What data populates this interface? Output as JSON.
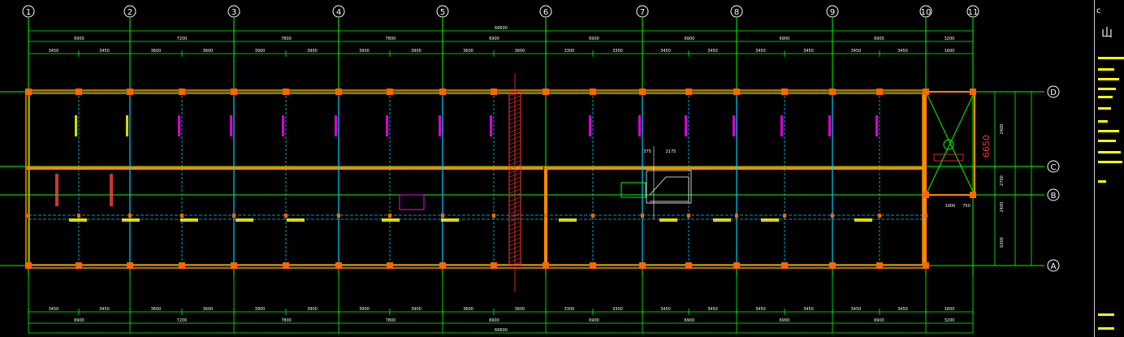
{
  "colors": {
    "background": "#000000",
    "axis_line": "#00ff00",
    "wall": "#ff8800",
    "column": "#ff6600",
    "beam": "#00ccff",
    "annotation_magenta": "#ff00ff",
    "annotation_yellow": "#ffff00",
    "dimension_text": "#ffffff",
    "hatch": "#ff3333"
  },
  "axes": {
    "vertical": [
      {
        "id": "1",
        "label": "1"
      },
      {
        "id": "2",
        "label": "2"
      },
      {
        "id": "3",
        "label": "3"
      },
      {
        "id": "4",
        "label": "4"
      },
      {
        "id": "5",
        "label": "5"
      },
      {
        "id": "6",
        "label": "6"
      },
      {
        "id": "7",
        "label": "7"
      },
      {
        "id": "8",
        "label": "8"
      },
      {
        "id": "9",
        "label": "9"
      },
      {
        "id": "10",
        "label": "10"
      },
      {
        "id": "11",
        "label": "11"
      }
    ],
    "horizontal": [
      {
        "id": "D",
        "label": "D"
      },
      {
        "id": "C",
        "label": "C"
      },
      {
        "id": "B",
        "label": "B"
      },
      {
        "id": "A",
        "label": "A"
      }
    ]
  },
  "dimensions": {
    "top_total": "66600",
    "bottom_total": "66600",
    "top_bays": [
      "6900",
      "7200",
      "7800",
      "7800",
      "6900",
      "6900",
      "6900",
      "6900",
      "6900",
      "3200"
    ],
    "bottom_bays": [
      "6900",
      "7200",
      "7800",
      "7800",
      "6900",
      "6900",
      "6900",
      "6900",
      "6900",
      "3200"
    ],
    "top_sub": [
      "3450",
      "3450",
      "3600",
      "3600",
      "3900",
      "3900",
      "3900",
      "3900",
      "3600",
      "3600",
      "3300",
      "3300",
      "3450",
      "3450",
      "3450",
      "3450",
      "3450",
      "3450",
      "1600"
    ],
    "bottom_sub": [
      "3450",
      "3450",
      "3600",
      "3600",
      "3900",
      "3900",
      "3900",
      "3900",
      "3600",
      "3600",
      "3300",
      "3300",
      "3450",
      "3450",
      "3450",
      "3450",
      "3450",
      "3450",
      "1600"
    ],
    "right_side": [
      "2400",
      "2700",
      "2400",
      "6300"
    ],
    "stair_width": "6650",
    "stair_bottom": [
      "1000",
      "750"
    ],
    "ramp_dims": [
      "375",
      "2175"
    ]
  },
  "title_block": {
    "header": "c",
    "subtitle": "山"
  }
}
